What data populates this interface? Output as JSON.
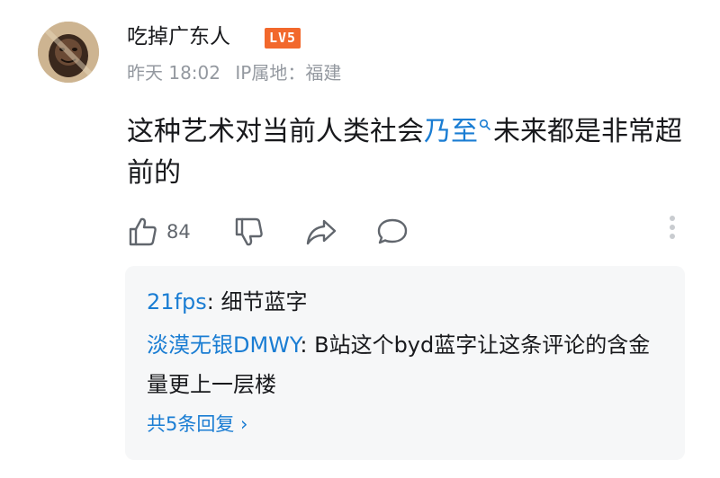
{
  "comment": {
    "username": "吃掉广东人",
    "level_badge": "LV5",
    "time": "昨天 18:02",
    "ip_location": "IP属地：福建",
    "text_before": "这种艺术对当前人类社会",
    "highlight_link": "乃至",
    "text_after": "未来都是非常超前的",
    "like_count": "84",
    "accent_color": "#1a7dd3",
    "level_color": "#f2682c"
  },
  "replies": [
    {
      "name": "21fps",
      "text": ": 细节蓝字"
    },
    {
      "name": "淡漠无银DMWY",
      "text": ": B站这个byd蓝字让这条评论的含金量更上一层楼"
    }
  ],
  "more_replies": "共5条回复 ›",
  "icons": [
    "thumbs-up-icon",
    "thumbs-down-icon",
    "share-icon",
    "comment-icon",
    "more-vertical-icon",
    "search-icon"
  ]
}
